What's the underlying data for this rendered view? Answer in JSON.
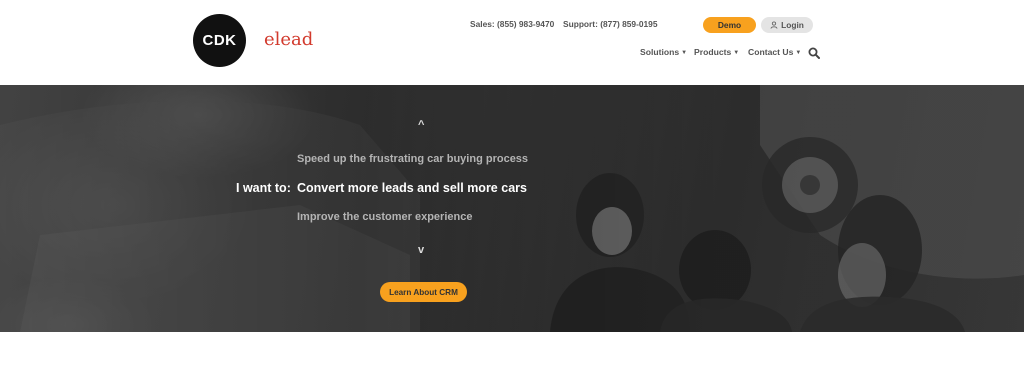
{
  "header": {
    "logo_text": "CDK",
    "brand_name": "elead",
    "sales": "Sales: (855) 983-9470",
    "support": "Support: (877) 859-0195",
    "demo_label": "Demo",
    "login_label": "Login",
    "nav": [
      {
        "label": "Solutions"
      },
      {
        "label": "Products"
      },
      {
        "label": "Contact Us"
      }
    ],
    "icons": [
      "user-icon",
      "search-icon",
      "caret-down-icon"
    ]
  },
  "hero": {
    "lead": "I want to:",
    "options": [
      "Speed up the frustrating car buying process",
      "Convert more leads and sell more cars",
      "Improve the customer experience"
    ],
    "selected_index": 1,
    "up_glyph": "^",
    "down_glyph": "v",
    "cta_label": "Learn About CRM"
  },
  "colors": {
    "accent": "#f8a11e",
    "brand_red": "#d23a2d",
    "logo_bg": "#111111",
    "hero_bg": "#3a3a3a"
  }
}
